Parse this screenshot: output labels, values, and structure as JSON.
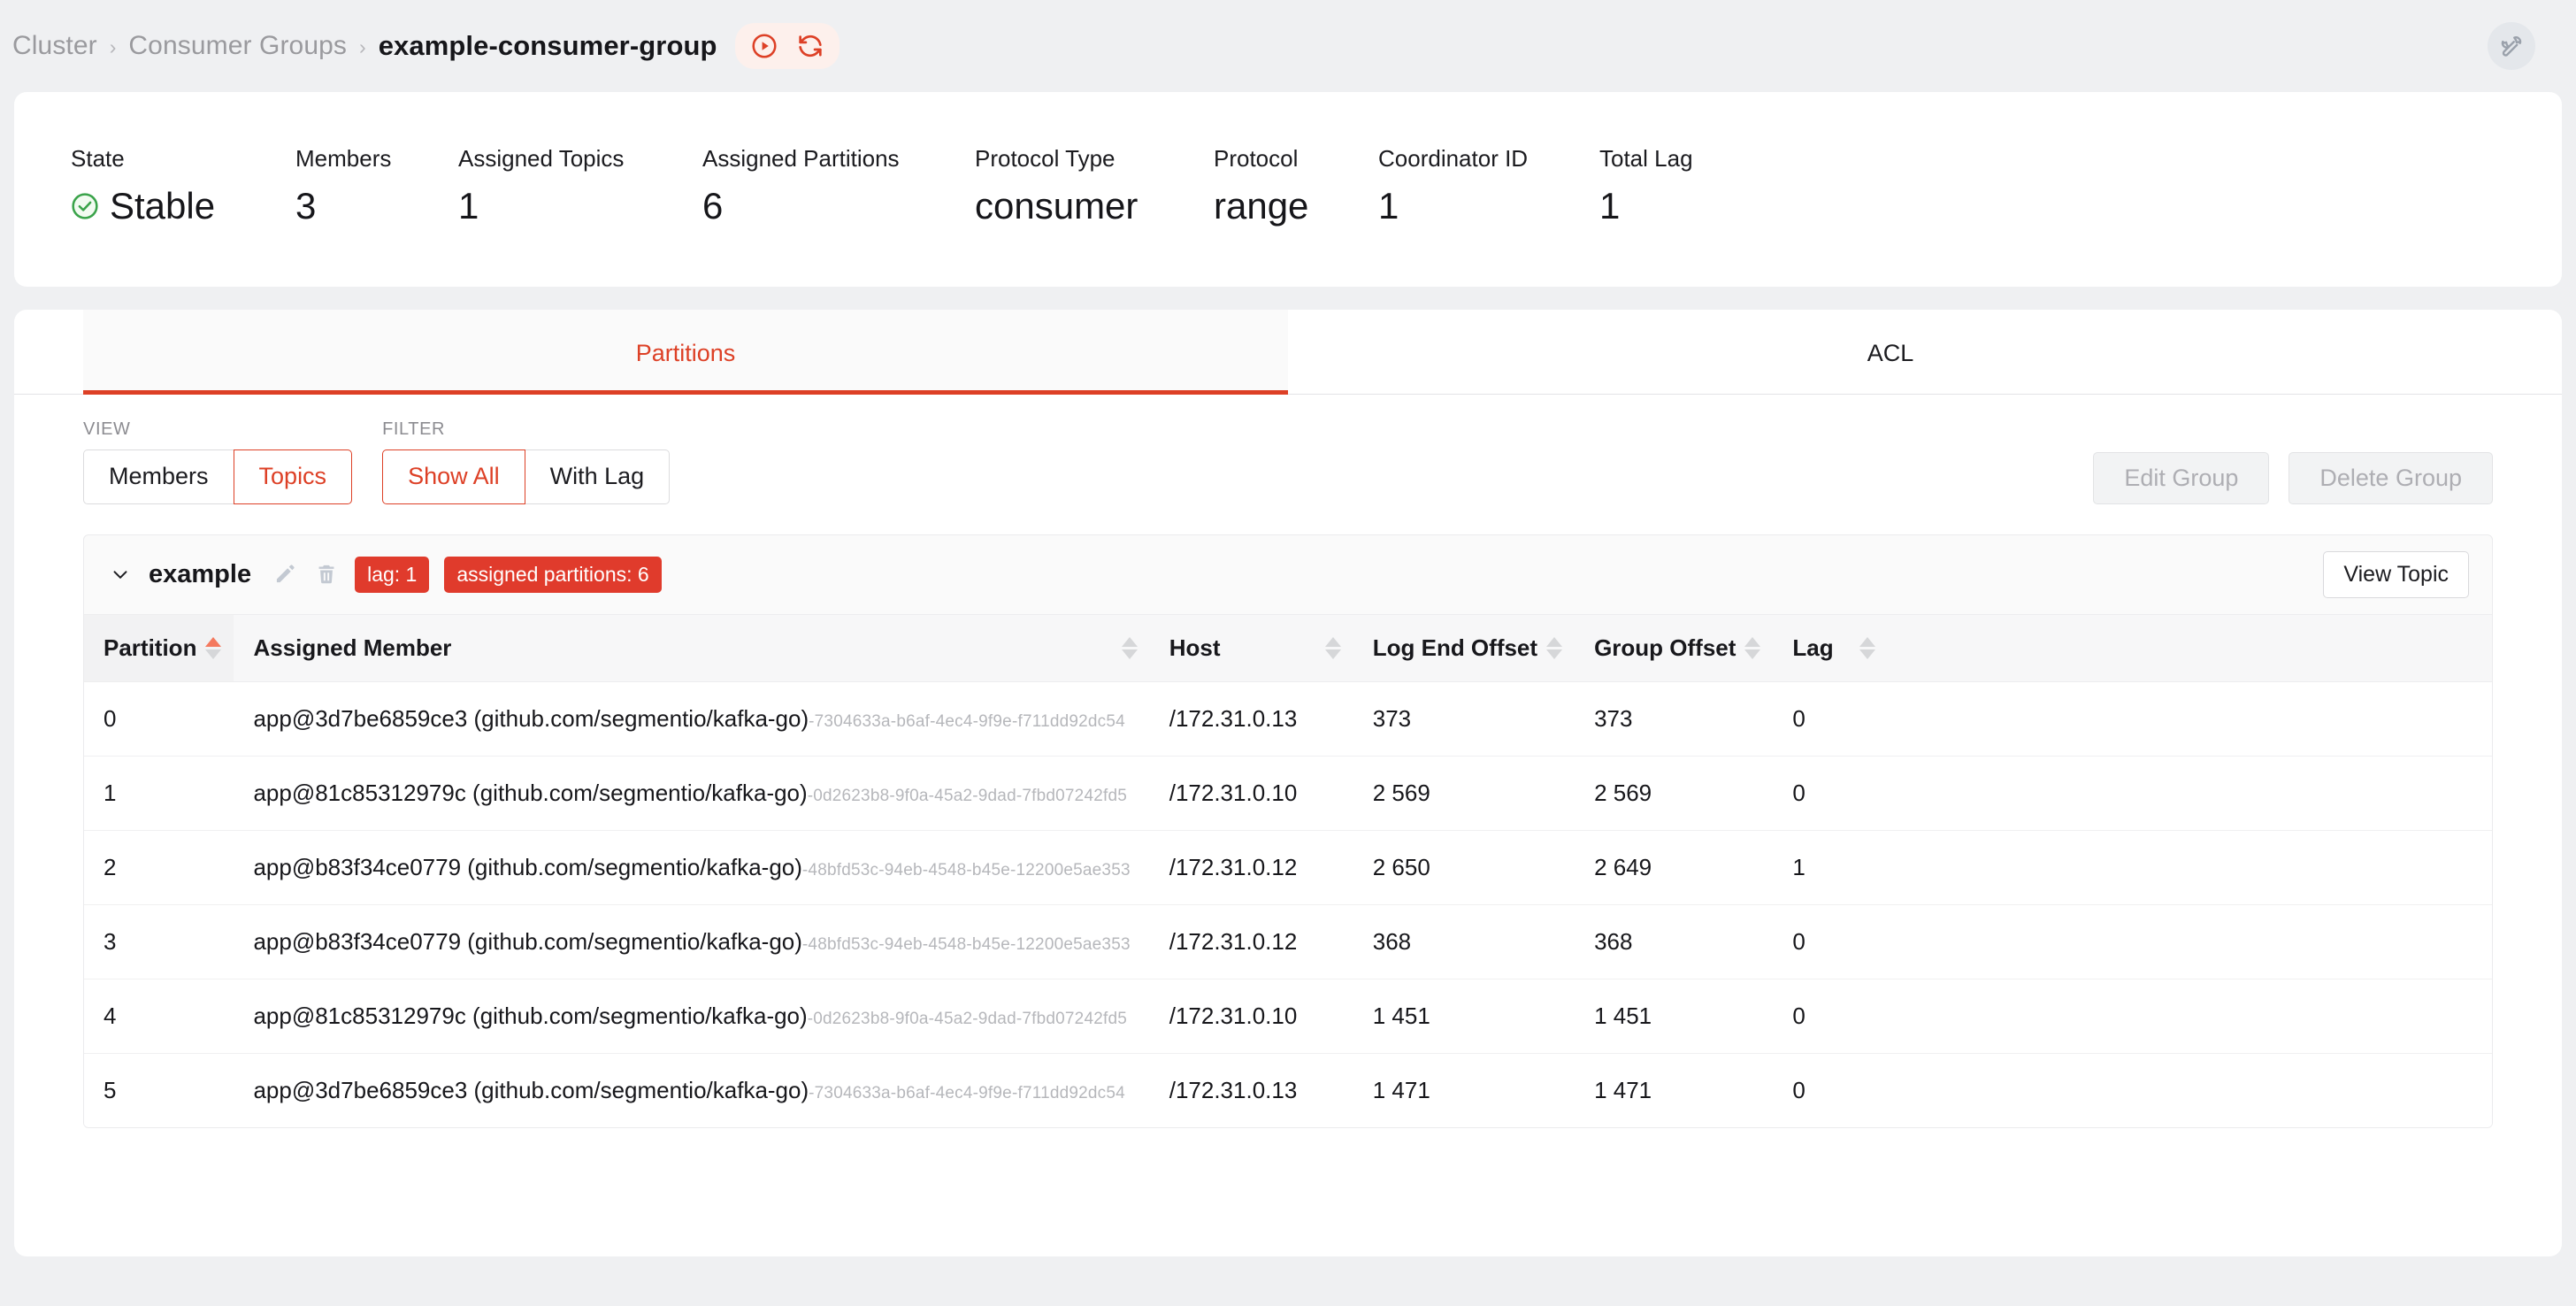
{
  "breadcrumb": {
    "items": [
      "Cluster",
      "Consumer Groups",
      "example-consumer-group"
    ],
    "separator": "›"
  },
  "header": {
    "play_icon": "play-circle-icon",
    "refresh_icon": "refresh-icon",
    "tools_icon": "wrench-icon",
    "accent_color": "#dd4026",
    "pill_bg": "#fdf0ec"
  },
  "stats": [
    {
      "label": "State",
      "value": "Stable",
      "icon": "check-circle-icon",
      "status_color": "#3aa34a"
    },
    {
      "label": "Members",
      "value": "3"
    },
    {
      "label": "Assigned Topics",
      "value": "1"
    },
    {
      "label": "Assigned Partitions",
      "value": "6"
    },
    {
      "label": "Protocol Type",
      "value": "consumer"
    },
    {
      "label": "Protocol",
      "value": "range"
    },
    {
      "label": "Coordinator ID",
      "value": "1"
    },
    {
      "label": "Total Lag",
      "value": "1"
    }
  ],
  "tabs": [
    {
      "label": "Partitions",
      "active": true
    },
    {
      "label": "ACL",
      "active": false
    }
  ],
  "controls": {
    "view_label": "VIEW",
    "view_options": [
      {
        "label": "Members",
        "active": false
      },
      {
        "label": "Topics",
        "active": true
      }
    ],
    "filter_label": "FILTER",
    "filter_options": [
      {
        "label": "Show All",
        "active": true
      },
      {
        "label": "With Lag",
        "active": false
      }
    ],
    "edit_group_label": "Edit Group",
    "delete_group_label": "Delete Group"
  },
  "topic": {
    "name": "example",
    "chevron_icon": "chevron-down-icon",
    "edit_icon": "pencil-icon",
    "delete_icon": "trash-icon",
    "badges": [
      {
        "text": "lag: 1"
      },
      {
        "text": "assigned partitions: 6"
      }
    ],
    "badge_color": "#e03b2c",
    "view_topic_label": "View Topic"
  },
  "table": {
    "columns": [
      {
        "label": "Partition",
        "sortable": true,
        "sorted": "asc"
      },
      {
        "label": "Assigned Member",
        "sortable": true,
        "sorted": "none"
      },
      {
        "label": "Host",
        "sortable": true,
        "sorted": "none"
      },
      {
        "label": "Log End Offset",
        "sortable": true,
        "sorted": "none"
      },
      {
        "label": "Group Offset",
        "sortable": true,
        "sorted": "none"
      },
      {
        "label": "Lag",
        "sortable": true,
        "sorted": "none"
      }
    ],
    "rows": [
      {
        "partition": "0",
        "member": "app@3d7be6859ce3 (github.com/segmentio/kafka-go)",
        "member_id": "-7304633a-b6af-4ec4-9f9e-f711dd92dc54",
        "host": "/172.31.0.13",
        "log_end_offset": "373",
        "group_offset": "373",
        "lag": "0"
      },
      {
        "partition": "1",
        "member": "app@81c85312979c (github.com/segmentio/kafka-go)",
        "member_id": "-0d2623b8-9f0a-45a2-9dad-7fbd07242fd5",
        "host": "/172.31.0.10",
        "log_end_offset": "2 569",
        "group_offset": "2 569",
        "lag": "0"
      },
      {
        "partition": "2",
        "member": "app@b83f34ce0779 (github.com/segmentio/kafka-go)",
        "member_id": "-48bfd53c-94eb-4548-b45e-12200e5ae353",
        "host": "/172.31.0.12",
        "log_end_offset": "2 650",
        "group_offset": "2 649",
        "lag": "1"
      },
      {
        "partition": "3",
        "member": "app@b83f34ce0779 (github.com/segmentio/kafka-go)",
        "member_id": "-48bfd53c-94eb-4548-b45e-12200e5ae353",
        "host": "/172.31.0.12",
        "log_end_offset": "368",
        "group_offset": "368",
        "lag": "0"
      },
      {
        "partition": "4",
        "member": "app@81c85312979c (github.com/segmentio/kafka-go)",
        "member_id": "-0d2623b8-9f0a-45a2-9dad-7fbd07242fd5",
        "host": "/172.31.0.10",
        "log_end_offset": "1 451",
        "group_offset": "1 451",
        "lag": "0"
      },
      {
        "partition": "5",
        "member": "app@3d7be6859ce3 (github.com/segmentio/kafka-go)",
        "member_id": "-7304633a-b6af-4ec4-9f9e-f711dd92dc54",
        "host": "/172.31.0.13",
        "log_end_offset": "1 471",
        "group_offset": "1 471",
        "lag": "0"
      }
    ]
  }
}
